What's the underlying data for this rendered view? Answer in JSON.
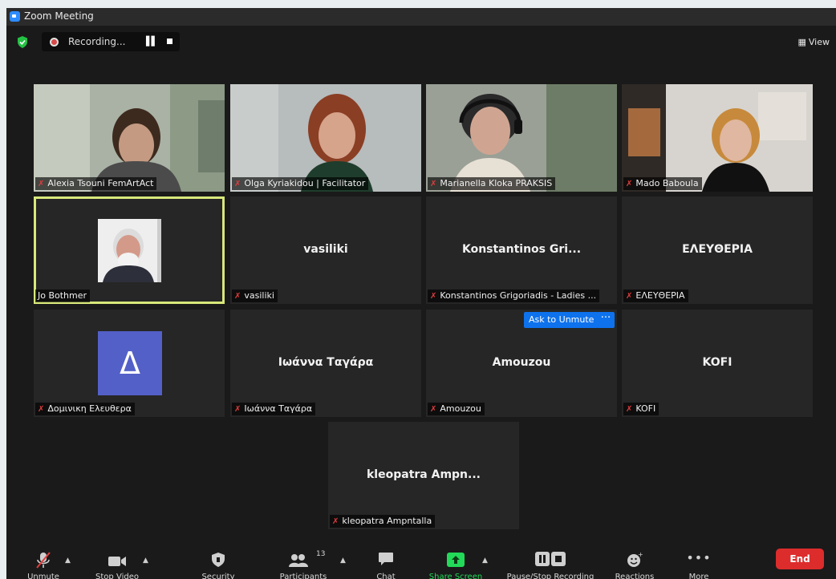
{
  "window": {
    "title": "Zoom Meeting"
  },
  "recording": {
    "status": "Recording..."
  },
  "view_label": "View",
  "tiles": [
    {
      "label": "Alexia Tsouni FemArtAct",
      "center": "",
      "muted": true
    },
    {
      "label": "Olga Kyriakidou | Facilitator",
      "center": "",
      "muted": true
    },
    {
      "label": "Marianella Kloka PRAKSIS",
      "center": "",
      "muted": true
    },
    {
      "label": "Mado Baboula",
      "center": "",
      "muted": true
    },
    {
      "label": "Jo Bothmer",
      "center": "",
      "muted": false
    },
    {
      "label": "vasiliki",
      "center": "vasiliki",
      "muted": true
    },
    {
      "label": "Konstantinos Grigoriadis - Ladies ...",
      "center": "Konstantinos  Gri...",
      "muted": true
    },
    {
      "label": "ΕΛΕΥΘΕΡΙΑ",
      "center": "ΕΛΕΥΘΕΡΙΑ",
      "muted": true
    },
    {
      "label": "Δομινικη Ελευθερα",
      "center": "",
      "avatar_letter": "Δ",
      "muted": true
    },
    {
      "label": "Ιωάννα Ταγάρα",
      "center": "Ιωάννα Ταγάρα",
      "muted": true
    },
    {
      "label": "Amouzou",
      "center": "Amouzou",
      "muted": true
    },
    {
      "label": "KOFI",
      "center": "KOFI",
      "muted": true
    },
    {
      "label": "kleopatra  Ampntalla",
      "center": "kleopatra  Ampn...",
      "muted": true
    }
  ],
  "ask_to_unmute": "Ask to Unmute",
  "ask_more": "···",
  "toolbar": {
    "unmute": "Unmute",
    "stop_video": "Stop Video",
    "security": "Security",
    "participants": "Participants",
    "participants_count": "13",
    "chat": "Chat",
    "share_screen": "Share Screen",
    "pause_stop_recording": "Pause/Stop Recording",
    "reactions": "Reactions",
    "more": "More",
    "end": "End"
  },
  "colors": {
    "accent_blue": "#0e72ed",
    "share_green": "#23d959",
    "end_red": "#dd2c2c",
    "active_speaker": "#d8e87a",
    "mute_red": "#e03d3d"
  }
}
